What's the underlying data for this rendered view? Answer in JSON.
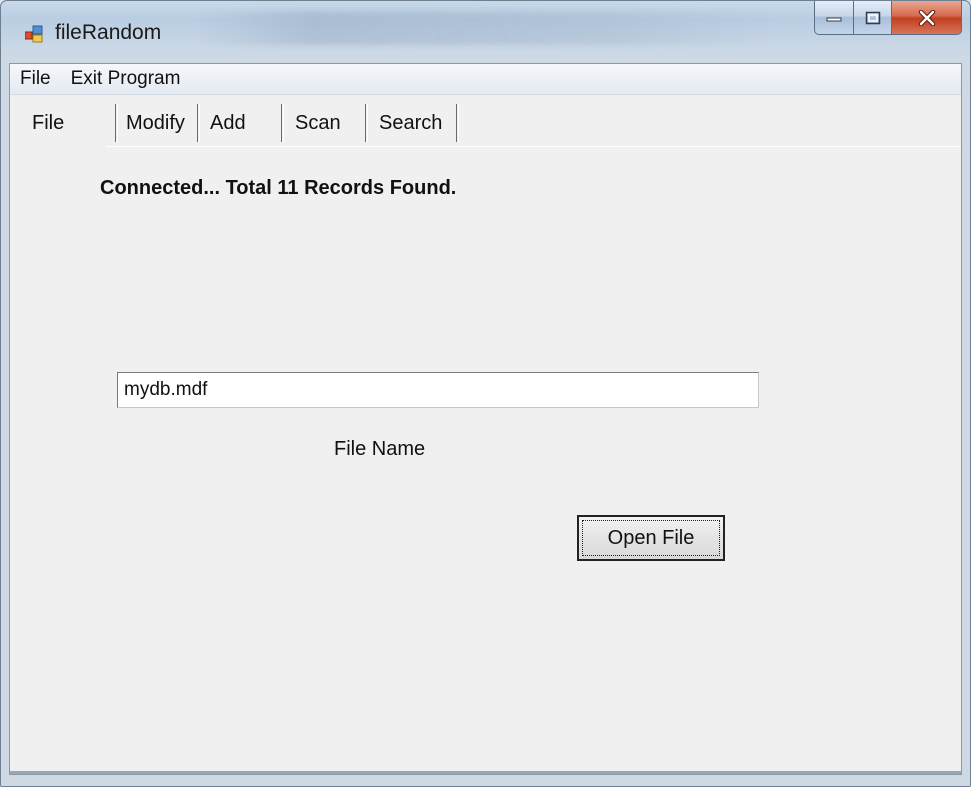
{
  "window": {
    "title": "fileRandom",
    "accent_close": "#c1401e",
    "titlebar_color": "#b9cde2"
  },
  "menu": {
    "items": [
      {
        "label": "File"
      },
      {
        "label": "Exit Program"
      }
    ]
  },
  "tabs": [
    {
      "label": "File",
      "selected": true
    },
    {
      "label": "Modify"
    },
    {
      "label": "Add"
    },
    {
      "label": "Scan"
    },
    {
      "label": "Search"
    }
  ],
  "main": {
    "status": "Connected... Total 11 Records Found.",
    "file_input_value": "mydb.mdf",
    "file_label": "File Name",
    "open_button_label": "Open File"
  }
}
